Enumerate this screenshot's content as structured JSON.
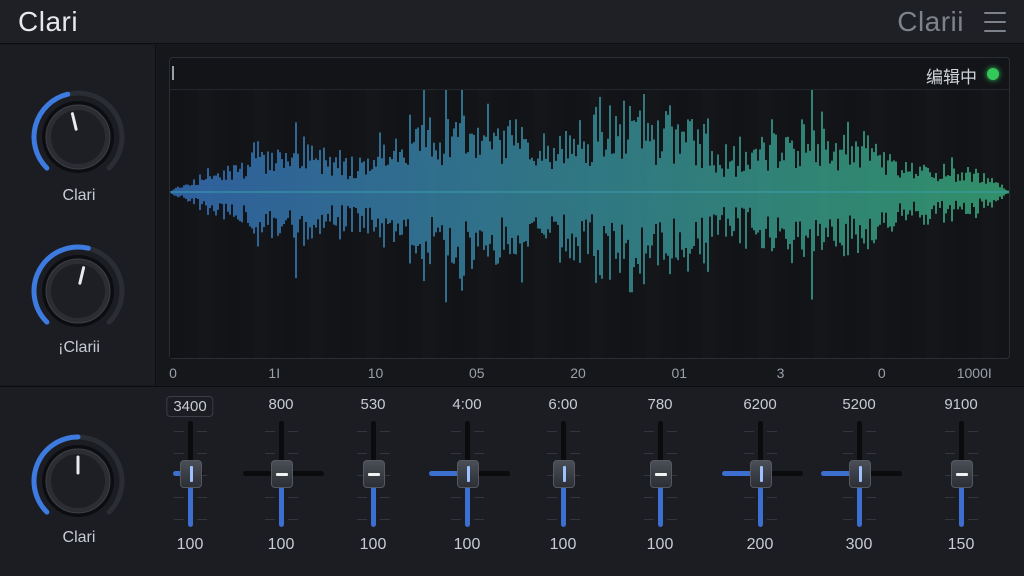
{
  "header": {
    "title": "Clari",
    "brand": "Clarii",
    "menu_icon": "hamburger-menu-icon"
  },
  "left_knobs": [
    {
      "label": "Clari",
      "value_fraction": 0.45
    },
    {
      "label": "¡Clarii",
      "value_fraction": 0.55
    }
  ],
  "bottom_knob": {
    "label": "Clari",
    "value_fraction": 0.5
  },
  "waveform": {
    "status_text": "编辑中",
    "status_color": "#34c759",
    "gradient_start": "#3b7fd6",
    "gradient_end": "#3ec48a",
    "timeline": [
      "0",
      "1I",
      "10",
      "05",
      "20",
      "01",
      "3",
      "0",
      "1000I"
    ]
  },
  "eq_bands": [
    {
      "freq": "3400",
      "value": "100",
      "boxed": true,
      "v_level": 0.7,
      "h_left": 0.4,
      "h_right": 0.2,
      "cap": "v"
    },
    {
      "freq": "800",
      "value": "100",
      "boxed": false,
      "v_level": 0.0,
      "h_left": 0.9,
      "h_right": 0.9,
      "cap": "h"
    },
    {
      "freq": "530",
      "value": "100",
      "boxed": false,
      "v_level": 0.3,
      "h_left": 0.0,
      "h_right": 0.0,
      "cap": "h"
    },
    {
      "freq": "4:00",
      "value": "100",
      "boxed": false,
      "v_level": 0.55,
      "h_left": 0.9,
      "h_right": 0.9,
      "cap": "v"
    },
    {
      "freq": "6:00",
      "value": "100",
      "boxed": false,
      "v_level": 0.4,
      "h_left": 0.0,
      "h_right": 0.0,
      "cap": "v"
    },
    {
      "freq": "780",
      "value": "100",
      "boxed": false,
      "v_level": 0.3,
      "h_left": 0.0,
      "h_right": 0.0,
      "cap": "h"
    },
    {
      "freq": "6200",
      "value": "200",
      "boxed": false,
      "v_level": 0.45,
      "h_left": 0.9,
      "h_right": 0.9,
      "cap": "v"
    },
    {
      "freq": "5200",
      "value": "300",
      "boxed": false,
      "v_level": 0.5,
      "h_left": 0.9,
      "h_right": 0.9,
      "cap": "v"
    },
    {
      "freq": "9100",
      "value": "150",
      "boxed": false,
      "v_level": 0.3,
      "h_left": 0.0,
      "h_right": 0.0,
      "cap": "h"
    }
  ]
}
